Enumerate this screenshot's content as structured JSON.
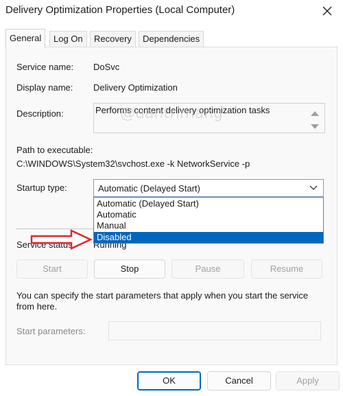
{
  "window": {
    "title": "Delivery Optimization Properties (Local Computer)"
  },
  "tabs": [
    {
      "label": "General",
      "active": true
    },
    {
      "label": "Log On"
    },
    {
      "label": "Recovery"
    },
    {
      "label": "Dependencies"
    }
  ],
  "general": {
    "service_name_label": "Service name:",
    "service_name_value": "DoSvc",
    "display_name_label": "Display name:",
    "display_name_value": "Delivery Optimization",
    "description_label": "Description:",
    "description_value": "Performs content delivery optimization tasks",
    "path_label": "Path to executable:",
    "path_value": "C:\\WINDOWS\\System32\\svchost.exe -k NetworkService -p",
    "startup_type_label": "Startup type:",
    "startup_type_value": "Automatic (Delayed Start)",
    "startup_options": [
      "Automatic (Delayed Start)",
      "Automatic",
      "Manual",
      "Disabled"
    ],
    "highlighted_option": "Disabled",
    "service_status_label": "Service status:",
    "service_status_value": "Running",
    "info_text_line1": "You can specify the start parameters that apply when you start the service",
    "info_text_line2": "from here.",
    "start_params_label": "Start parameters:"
  },
  "service_buttons": {
    "start": "Start",
    "stop": "Stop",
    "pause": "Pause",
    "resume": "Resume"
  },
  "footer": {
    "ok": "OK",
    "cancel": "Cancel",
    "apply": "Apply"
  },
  "watermark": "@uantrimang",
  "colors": {
    "accent": "#0067c0",
    "annotation_arrow": "#e0262b"
  },
  "icons": {
    "close": "close-icon",
    "dropdown": "chevron-down-icon",
    "annotation": "red-arrow-icon"
  }
}
